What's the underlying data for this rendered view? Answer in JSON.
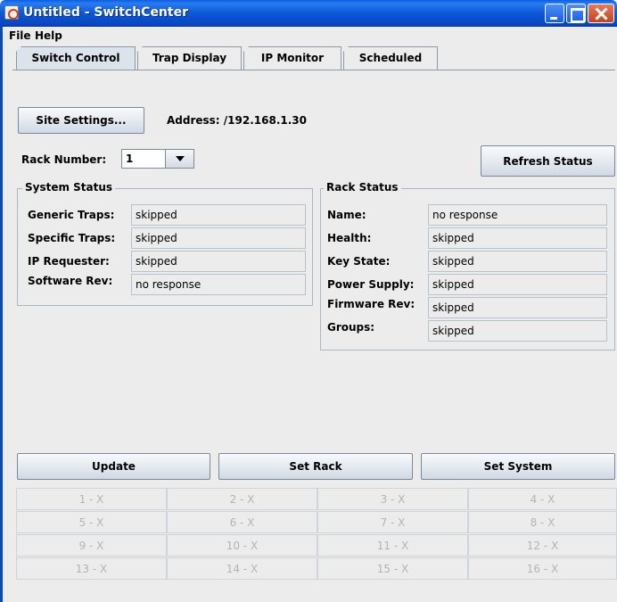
{
  "window": {
    "title": "Untitled - SwitchCenter"
  },
  "menubar": {
    "file": "File",
    "help": "Help"
  },
  "tabs": [
    {
      "label": "Switch Control"
    },
    {
      "label": "Trap Display"
    },
    {
      "label": "IP Monitor"
    },
    {
      "label": "Scheduled"
    }
  ],
  "switch_control": {
    "site_settings_label": "Site Settings...",
    "address": "Address: /192.168.1.30",
    "rack_number_label": "Rack Number:",
    "rack_number_value": "1",
    "refresh_label": "Refresh Status",
    "system_status": {
      "title": "System Status",
      "fields": [
        {
          "label": "Generic Traps:",
          "value": "skipped"
        },
        {
          "label": "Specific Traps:",
          "value": "skipped"
        },
        {
          "label": "IP Requester:",
          "value": "skipped"
        },
        {
          "label": "Software Rev:",
          "value": "no response"
        }
      ]
    },
    "rack_status": {
      "title": "Rack Status",
      "fields": [
        {
          "label": "Name:",
          "value": "no response"
        },
        {
          "label": "Health:",
          "value": "skipped"
        },
        {
          "label": "Key State:",
          "value": "skipped"
        },
        {
          "label": "Power Supply:",
          "value": "skipped"
        },
        {
          "label": "Firmware Rev:",
          "value": "skipped"
        },
        {
          "label": "Groups:",
          "value": "skipped"
        }
      ]
    },
    "update_label": "Update",
    "set_rack_label": "Set Rack",
    "set_system_label": "Set System",
    "grid": [
      "1 - X",
      "2 - X",
      "3 - X",
      "4 - X",
      "5 - X",
      "6 - X",
      "7 - X",
      "8 - X",
      "9 - X",
      "10 - X",
      "11 - X",
      "12 - X",
      "13 - X",
      "14 - X",
      "15 - X",
      "16 - X"
    ]
  }
}
